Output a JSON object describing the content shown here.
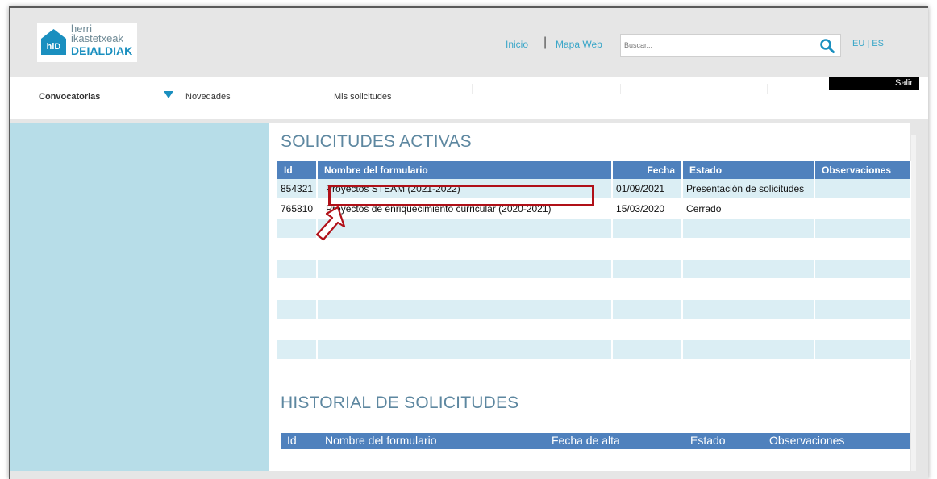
{
  "header": {
    "logo": {
      "line1": "herri",
      "line2": "ikastetxeak",
      "line3": "DEIALDIAK",
      "mark": "hiD"
    },
    "links": {
      "inicio": "Inicio",
      "separator": "|",
      "mapa": "Mapa Web"
    },
    "search": {
      "placeholder": "Buscar...",
      "icon": "search-icon"
    },
    "lang": "EU | ES"
  },
  "nav": {
    "convocatorias": "Convocatorias",
    "novedades": "Novedades",
    "mis_solicitudes": "Mis solicitudes",
    "salir": "Salir"
  },
  "activas": {
    "title": "SOLICITUDES ACTIVAS",
    "columns": [
      "Id",
      "Nombre del formulario",
      "Fecha",
      "Estado",
      "Observaciones"
    ],
    "rows": [
      {
        "id": "854321",
        "nombre": "Proyectos STEAM (2021-2022)",
        "fecha": "01/09/2021",
        "estado": "Presentación de solicitudes",
        "obs": ""
      },
      {
        "id": "765810",
        "nombre": "Proyectos de enriquecimiento curricular (2020-2021)",
        "fecha": "15/03/2020",
        "estado": "Cerrado",
        "obs": ""
      }
    ]
  },
  "historial": {
    "title": "HISTORIAL DE SOLICITUDES",
    "columns": [
      "Id",
      "Nombre del formulario",
      "Fecha de alta",
      "Estado",
      "Observaciones"
    ]
  },
  "colors": {
    "accent": "#4f81bd",
    "sidebar": "#b7dde8",
    "highlight": "#b01018",
    "link": "#3aa6c8"
  }
}
